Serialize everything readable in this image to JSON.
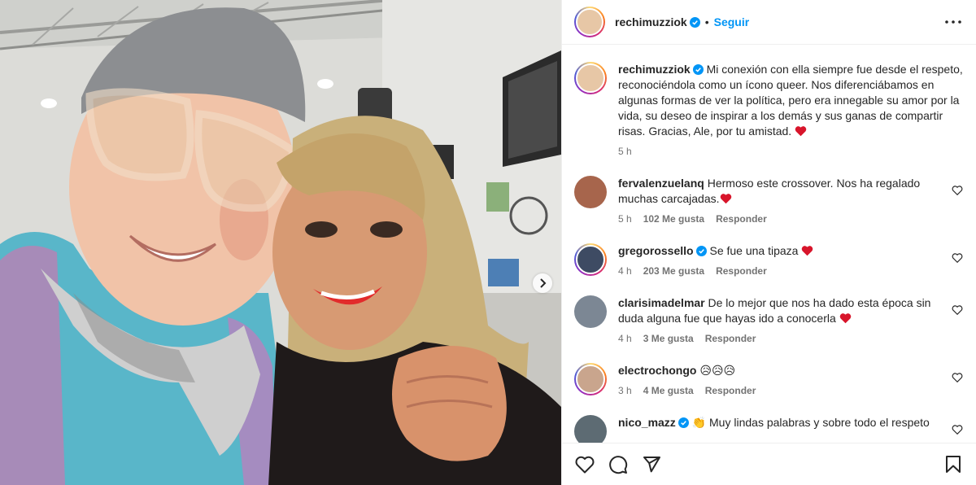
{
  "post": {
    "username": "rechimuzziok",
    "follow_label": "Seguir",
    "separator": "•",
    "caption": "Mi conexión con ella siempre fue desde el respeto, reconociéndola como un ícono queer. Nos diferenciábamos en algunas formas de ver la política, pero era innegable su amor por la vida, su deseo de inspirar a los demás y sus ganas de compartir risas. Gracias, Ale, por tu amistad.",
    "caption_time": "5 h"
  },
  "comments": [
    {
      "username": "fervalenzuelanq",
      "verified": false,
      "text": "Hermoso este crossover. Nos ha regalado muchas carcajadas.",
      "heart": true,
      "time": "5 h",
      "likes": "102 Me gusta",
      "reply": "Responder"
    },
    {
      "username": "gregorossello",
      "verified": true,
      "text": "Se fue una tipaza",
      "heart": true,
      "time": "4 h",
      "likes": "203 Me gusta",
      "reply": "Responder"
    },
    {
      "username": "clarisimadelmar",
      "verified": false,
      "text": "De lo mejor que nos ha dado esta época sin duda alguna fue que hayas ido a conocerla",
      "heart": true,
      "time": "4 h",
      "likes": "3 Me gusta",
      "reply": "Responder"
    },
    {
      "username": "electrochongo",
      "verified": false,
      "text": "😥😥😥",
      "heart": false,
      "time": "3 h",
      "likes": "4 Me gusta",
      "reply": "Responder"
    },
    {
      "username": "nico_mazz",
      "verified": true,
      "text": "👏 Muy lindas palabras y sobre todo el respeto",
      "heart": false,
      "time": "",
      "likes": "",
      "reply": ""
    }
  ],
  "icons": {
    "heart": "heart-icon",
    "comment": "comment-icon",
    "share": "share-icon",
    "save": "bookmark-icon",
    "more": "more-options-icon",
    "verified": "verified-badge-icon",
    "next": "chevron-right-icon"
  },
  "colors": {
    "accent": "#0095f6",
    "heart": "#ed4956",
    "text": "#262626",
    "muted": "#737373"
  }
}
